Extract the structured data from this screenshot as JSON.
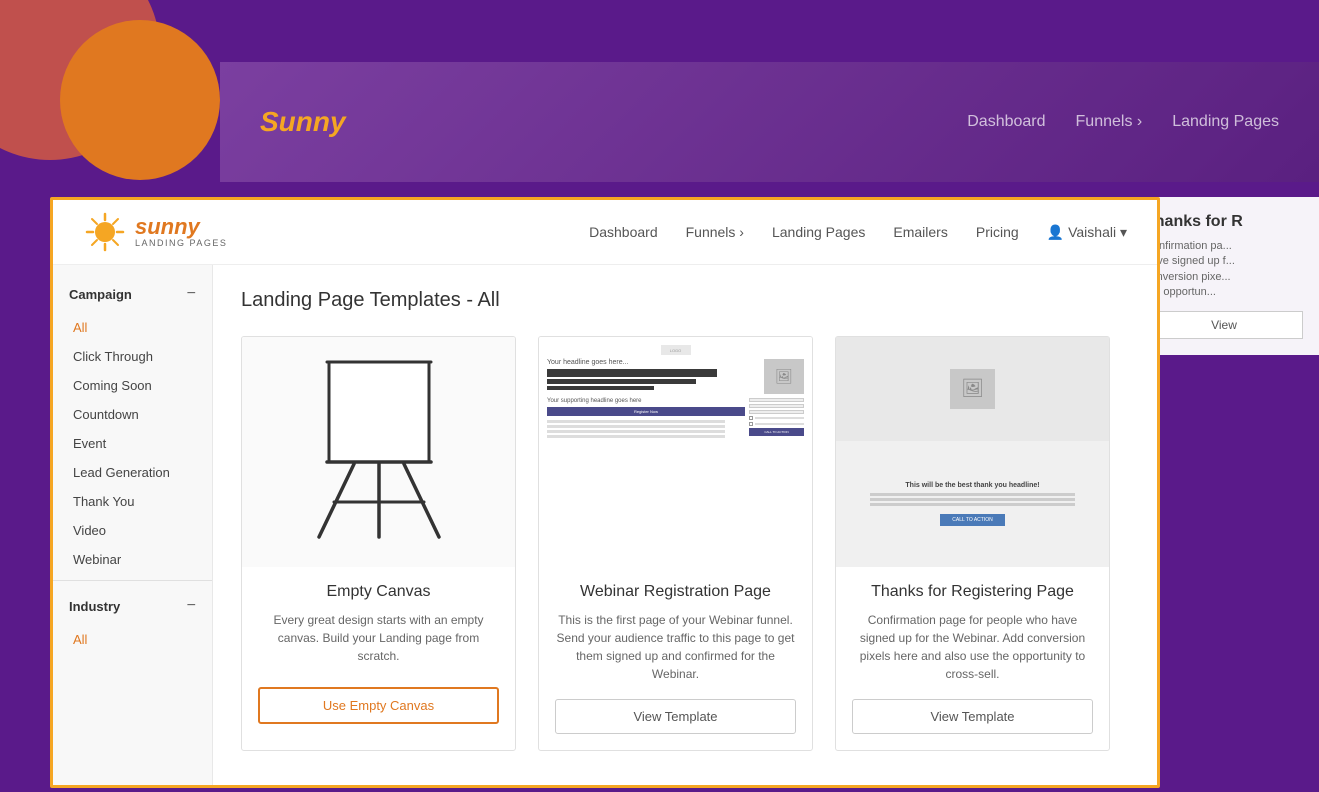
{
  "background": {
    "nav": {
      "logo": "Sunny",
      "links": [
        "Dashboard",
        "Funnels ›",
        "Landing Pages"
      ]
    }
  },
  "modal": {
    "nav": {
      "logo": {
        "sunny": "sunny",
        "sub": "LANDING PAGES"
      },
      "links": [
        "Dashboard",
        "Funnels ›",
        "Landing Pages",
        "Emailers",
        "Pricing"
      ],
      "user": "Vaishali ▾"
    },
    "page_title": "Landing Page Templates - All",
    "sidebar": {
      "campaign_label": "Campaign",
      "campaign_items": [
        "All",
        "Click Through",
        "Coming Soon",
        "Countdown",
        "Event",
        "Lead Generation",
        "Thank You",
        "Video",
        "Webinar"
      ],
      "industry_label": "Industry",
      "industry_items": [
        "All"
      ]
    },
    "templates": [
      {
        "id": "empty-canvas",
        "name": "Empty Canvas",
        "description": "Every great design starts with an empty canvas. Build your Landing page from scratch.",
        "button_label": "Use Empty Canvas",
        "button_type": "primary"
      },
      {
        "id": "webinar-registration",
        "name": "Webinar Registration Page",
        "description": "This is the first page of your Webinar funnel. Send your audience traffic to this page to get them signed up and confirmed for the Webinar.",
        "button_label": "View Template",
        "button_type": "secondary"
      },
      {
        "id": "thanks-registering",
        "name": "Thanks for Registering Page",
        "description": "Confirmation page for people who have signed up for the Webinar. Add conversion pixels here and also use the opportunity to cross-sell.",
        "button_label": "View Template",
        "button_type": "secondary"
      }
    ],
    "partial": {
      "title": "Thanks for R",
      "text": "Confirmation pa... have signed up f... conversion pixe... the opportun...",
      "button": "View"
    }
  }
}
